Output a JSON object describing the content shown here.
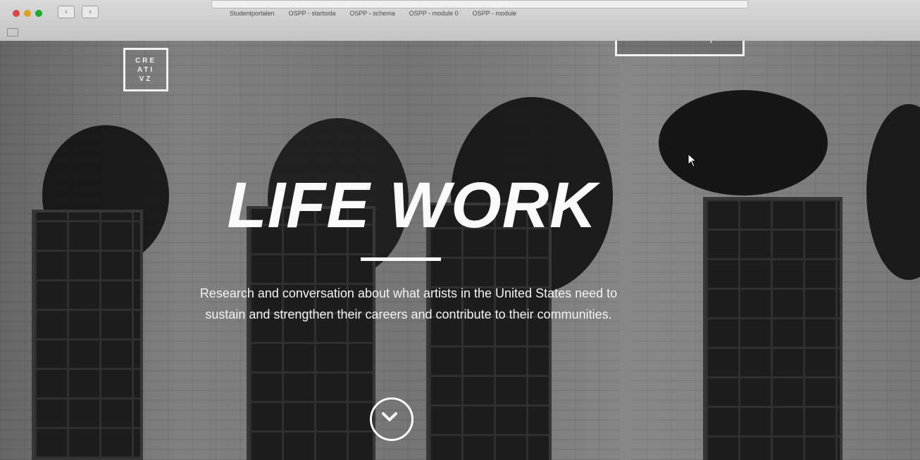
{
  "browser": {
    "bookmarks": [
      "Studentportalen",
      "OSPP - startsida",
      "OSPP - schema",
      "OSPP - module 0",
      "OSPP - module"
    ]
  },
  "site": {
    "logo_lines": [
      "CRE",
      "ATI",
      "VZ"
    ],
    "report_button": "The Research Report"
  },
  "hero": {
    "title": "LIFE WORK",
    "description": "Research and conversation about what artists in the United States need to sustain and strengthen their careers and contribute to their communities."
  },
  "icons": {
    "scroll_down": "chevron-down-circle-icon",
    "cursor": "mouse-pointer-icon"
  },
  "colors": {
    "text": "#fafafa",
    "overlay": "#000000"
  }
}
